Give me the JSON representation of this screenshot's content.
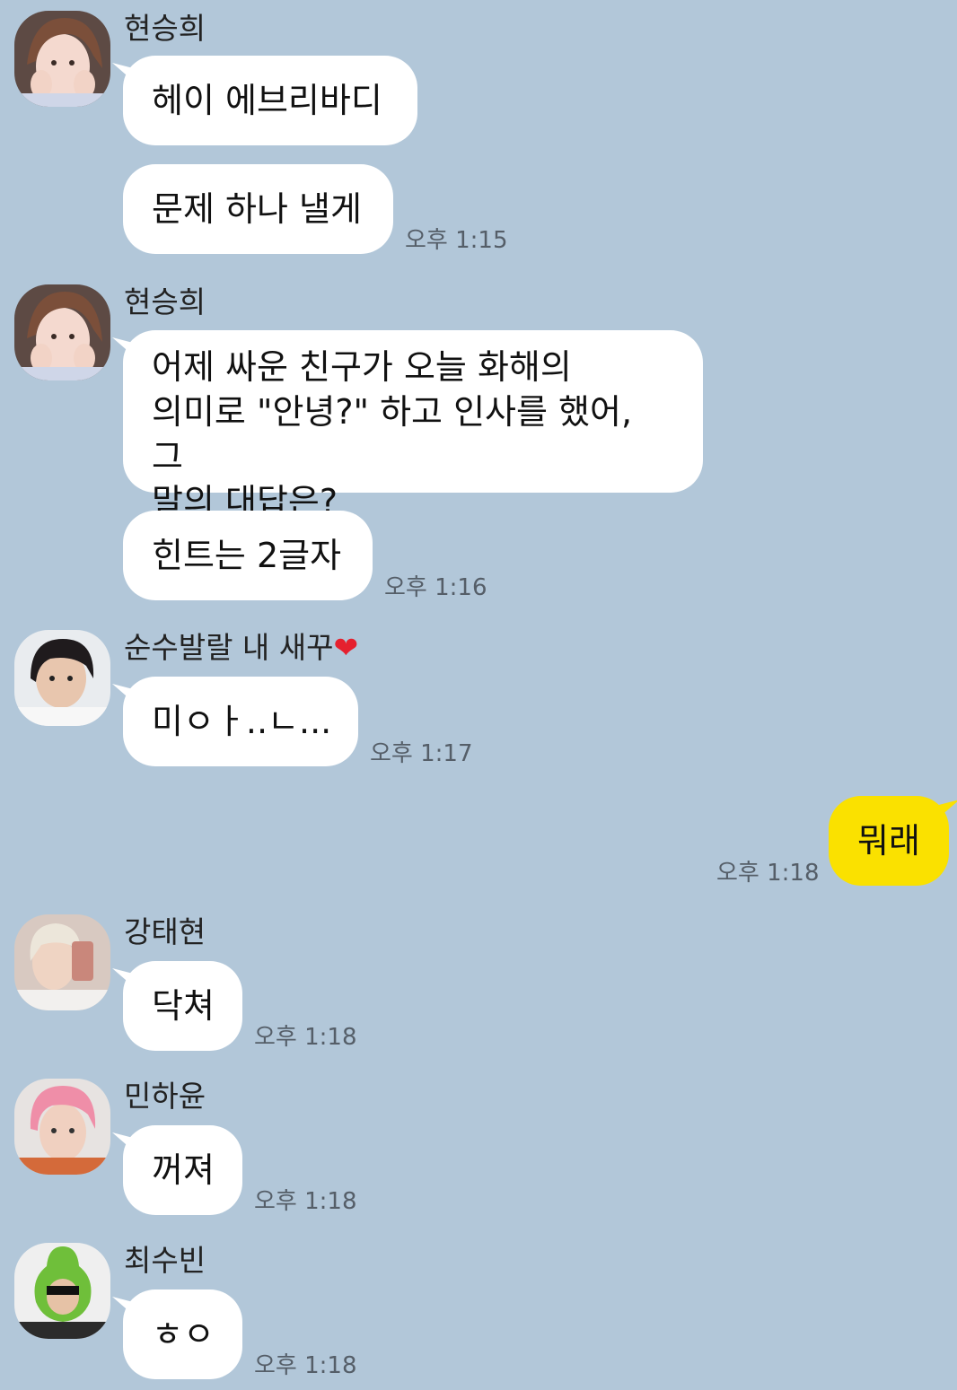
{
  "messages": [
    {
      "sender": "현승희",
      "bubbles": [
        "헤이 에브리바디",
        "문제 하나 낼게"
      ],
      "time": "오후 1:15"
    },
    {
      "sender": "현승희",
      "bubbles": [
        [
          "어제 싸운 친구가 오늘 화해의",
          "의미로 \"안녕?\" 하고 인사를 했어, 그",
          "말의 대답은?"
        ],
        "힌트는 2글자"
      ],
      "time": "오후 1:16"
    },
    {
      "sender_name": "순수발랄 내 새꾸",
      "sender_emoji": "❤",
      "bubbles": [
        "미ㅇㅏ..ㄴ..."
      ],
      "time": "오후 1:17"
    },
    {
      "mine": true,
      "bubbles": [
        "뭐래"
      ],
      "time": "오후 1:18"
    },
    {
      "sender": "강태현",
      "bubbles": [
        "닥쳐"
      ],
      "time": "오후 1:18"
    },
    {
      "sender": "민하윤",
      "bubbles": [
        "꺼져"
      ],
      "time": "오후 1:18"
    },
    {
      "sender": "최수빈",
      "bubbles": [
        "ㅎㅇ"
      ],
      "time": "오후 1:18"
    }
  ],
  "icons": {
    "heart": "red-heart-icon",
    "avatar": "profile-avatar-icon"
  },
  "colors": {
    "background": "#b2c7d9",
    "bubble_other": "#ffffff",
    "bubble_mine": "#fae100",
    "time_text": "#555e68"
  }
}
